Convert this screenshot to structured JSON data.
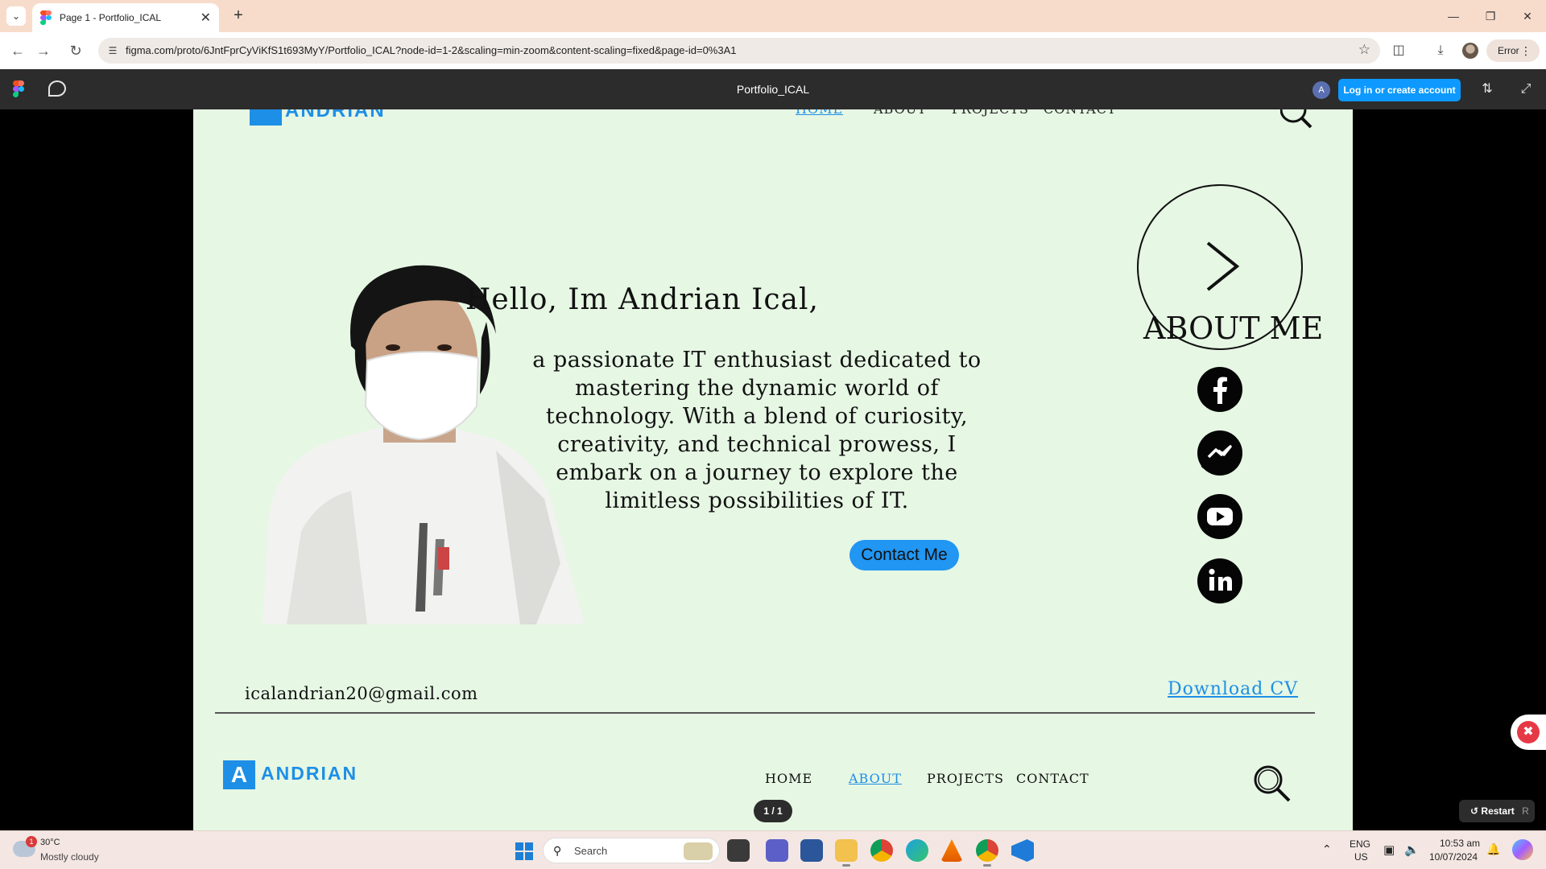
{
  "browser": {
    "tab_title": "Page 1 - Portfolio_ICAL",
    "url": "figma.com/proto/6JntFprCyViKfS1t693MyY/Portfolio_ICAL?node-id=1-2&scaling=min-zoom&content-scaling=fixed&page-id=0%3A1",
    "profile_status": "Error"
  },
  "figma": {
    "file_title": "Portfolio_ICAL",
    "avatar_letter": "A",
    "login_label": "Log in or create account",
    "page_indicator": "1 / 1",
    "restart_label": "Restart",
    "restart_key": "R"
  },
  "portfolio": {
    "top_nav": [
      "HOME",
      "ABOUT",
      "PROJECTS",
      "CONTACT"
    ],
    "greeting": "Hello, Im Andrian Ical,",
    "bio": "a passionate IT enthusiast dedicated to mastering the dynamic world of technology. With a blend of curiosity, creativity, and technical prowess, I embark on a journey to explore the limitless possibilities of IT.",
    "contact_button": "Contact Me",
    "about_label": "ABOUT ME",
    "social_icons": [
      "facebook-icon",
      "messenger-icon",
      "youtube-icon",
      "linkedin-icon"
    ],
    "email": "icalandrian20@gmail.com",
    "download_cv": "Download CV",
    "footer_logo_letter": "A",
    "footer_logo_word": "ANDRIAN",
    "footer_nav": {
      "home": "HOME",
      "about": "ABOUT",
      "projects": "PROJECTS",
      "contact": "CONTACT"
    },
    "accent_color": "#1e8fe6",
    "background_color": "#e6f7e4"
  },
  "taskbar": {
    "weather_badge": "1",
    "temperature": "30°C",
    "weather": "Mostly cloudy",
    "search_label": "Search",
    "language": "ENG",
    "region": "US",
    "time": "10:53 am",
    "date": "10/07/2024"
  }
}
